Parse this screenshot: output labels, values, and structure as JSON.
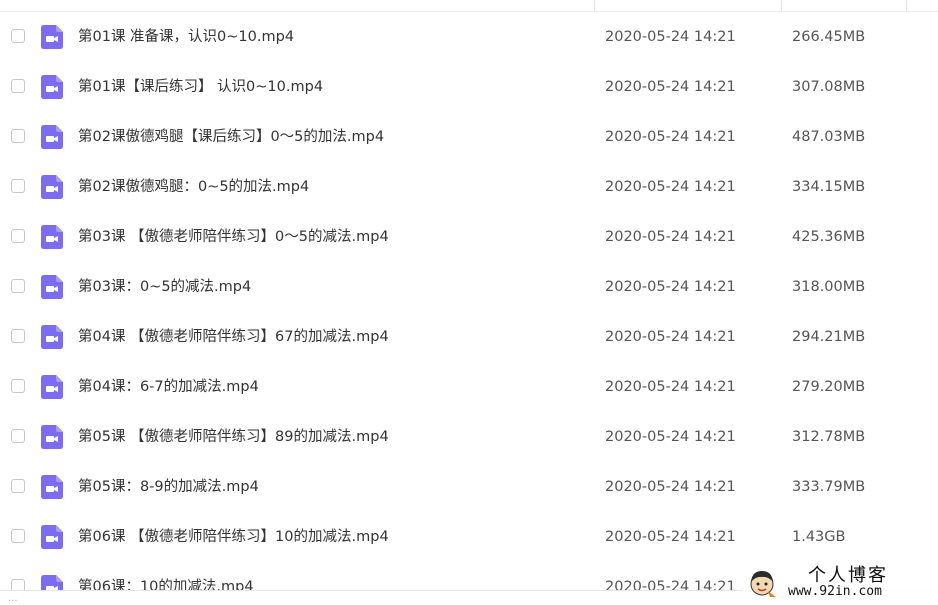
{
  "files": [
    {
      "name": "第01课 准备课，认识0~10.mp4",
      "date": "2020-05-24 14:21",
      "size": "266.45MB"
    },
    {
      "name": "第01课【课后练习】 认识0~10.mp4",
      "date": "2020-05-24 14:21",
      "size": "307.08MB"
    },
    {
      "name": "第02课傲德鸡腿【课后练习】0～5的加法.mp4",
      "date": "2020-05-24 14:21",
      "size": "487.03MB"
    },
    {
      "name": "第02课傲德鸡腿：0~5的加法.mp4",
      "date": "2020-05-24 14:21",
      "size": "334.15MB"
    },
    {
      "name": "第03课 【傲德老师陪伴练习】0～5的减法.mp4",
      "date": "2020-05-24 14:21",
      "size": "425.36MB"
    },
    {
      "name": "第03课：0~5的减法.mp4",
      "date": "2020-05-24 14:21",
      "size": "318.00MB"
    },
    {
      "name": "第04课 【傲德老师陪伴练习】67的加减法.mp4",
      "date": "2020-05-24 14:21",
      "size": "294.21MB"
    },
    {
      "name": "第04课：6-7的加减法.mp4",
      "date": "2020-05-24 14:21",
      "size": "279.20MB"
    },
    {
      "name": "第05课 【傲德老师陪伴练习】89的加减法.mp4",
      "date": "2020-05-24 14:21",
      "size": "312.78MB"
    },
    {
      "name": "第05课：8-9的加减法.mp4",
      "date": "2020-05-24 14:21",
      "size": "333.79MB"
    },
    {
      "name": "第06课 【傲德老师陪伴练习】10的加减法.mp4",
      "date": "2020-05-24 14:21",
      "size": "1.43GB"
    },
    {
      "name": "第06课：10的加减法.mp4",
      "date": "2020-05-24 14:21",
      "size": ""
    }
  ],
  "footer": {
    "hint": "..."
  },
  "watermark": {
    "title": "个人博客",
    "url": "www.92in.com"
  },
  "colors": {
    "file_icon": "#7b6cf0",
    "checkbox_border": "#c8c8c8",
    "text": "#333333",
    "muted": "#555555"
  },
  "icons": {
    "file": "video-file-icon",
    "avatar": "avatar-icon"
  }
}
